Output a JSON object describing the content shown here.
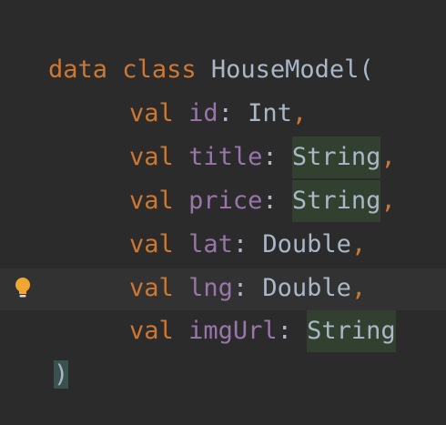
{
  "code": {
    "line1": {
      "keyword": "data class",
      "name": "HouseModel",
      "open": "("
    },
    "fields": [
      {
        "kw": "val",
        "name": "id",
        "colon": ":",
        "type": "Int",
        "comma": ","
      },
      {
        "kw": "val",
        "name": "title",
        "colon": ":",
        "type": "String",
        "comma": ","
      },
      {
        "kw": "val",
        "name": "price",
        "colon": ":",
        "type": "String",
        "comma": ","
      },
      {
        "kw": "val",
        "name": "lat",
        "colon": ":",
        "type": "Double",
        "comma": ","
      },
      {
        "kw": "val",
        "name": "lng",
        "colon": ":",
        "type": "Double",
        "comma": ","
      },
      {
        "kw": "val",
        "name": "imgUrl",
        "colon": ":",
        "type": "String",
        "comma": ""
      }
    ],
    "close": ")"
  },
  "gutter": {
    "icon": "lightbulb-icon",
    "icon_color": "#f0a732"
  },
  "colors": {
    "background": "#2b2b2b",
    "keyword": "#cc7832",
    "property": "#9876aa",
    "text": "#a9b7c6"
  }
}
